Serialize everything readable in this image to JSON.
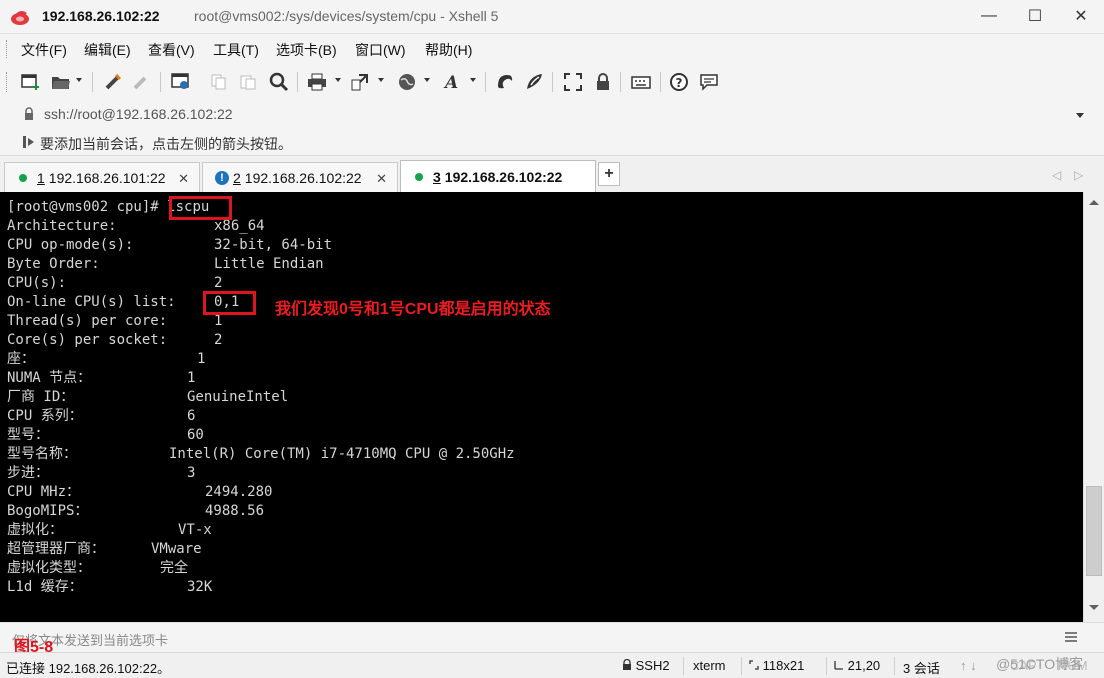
{
  "window": {
    "host": "192.168.26.102:22",
    "path_title": "root@vms002:/sys/devices/system/cpu - Xshell 5",
    "minimize_glyph": "—",
    "maximize_glyph": "☐",
    "close_glyph": "✕"
  },
  "menu": [
    "文件(F)",
    "编辑(E)",
    "查看(V)",
    "工具(T)",
    "选项卡(B)",
    "窗口(W)",
    "帮助(H)"
  ],
  "toolbar": {
    "icons": [
      "new-session-icon",
      "open-folder-icon",
      "reconnect-icon",
      "disconnect-icon",
      "properties-icon",
      "copy-icon",
      "paste-icon",
      "find-icon",
      "print-icon",
      "transfer-icon",
      "globe-icon",
      "font-icon",
      "xftp-icon",
      "xmanager-icon",
      "fullscreen-icon",
      "lock-icon",
      "keyboard-icon",
      "help-icon",
      "chat-icon"
    ]
  },
  "address": {
    "value": "ssh://root@192.168.26.102:22"
  },
  "hint": {
    "text": "要添加当前会话，点击左侧的箭头按钮。"
  },
  "tabs": [
    {
      "number": "1",
      "host": "192.168.26.101:22",
      "status": "connected",
      "active": false
    },
    {
      "number": "2",
      "host": "192.168.26.102:22",
      "status": "warning",
      "active": false
    },
    {
      "number": "3",
      "host": "192.168.26.102:22",
      "status": "connected",
      "active": true
    }
  ],
  "tab_add_glyph": "+",
  "tab_nav_left": "◁",
  "tab_nav_right": "▷",
  "terminal": {
    "prompt": "[root@vms002 cpu]# ",
    "command": "lscpu",
    "rows": [
      {
        "label": "Architecture:",
        "value": "x86_64"
      },
      {
        "label": "CPU op-mode(s):",
        "value": "32-bit, 64-bit"
      },
      {
        "label": "Byte Order:",
        "value": "Little Endian"
      },
      {
        "label": "CPU(s):",
        "value": "2"
      },
      {
        "label": "On-line CPU(s) list:",
        "value": "0,1"
      },
      {
        "label": "Thread(s) per core:",
        "value": "1"
      },
      {
        "label": "Core(s) per socket:",
        "value": "2"
      },
      {
        "label": "座：",
        "value": "1"
      },
      {
        "label": "NUMA 节点：",
        "value": "1"
      },
      {
        "label": "厂商 ID：",
        "value": "GenuineIntel"
      },
      {
        "label": "CPU 系列：",
        "value": "6"
      },
      {
        "label": "型号：",
        "value": "60"
      },
      {
        "label": "型号名称：",
        "value": "Intel(R) Core(TM) i7-4710MQ CPU @ 2.50GHz"
      },
      {
        "label": "步进：",
        "value": "3"
      },
      {
        "label": "CPU MHz：",
        "value": "2494.280"
      },
      {
        "label": "BogoMIPS：",
        "value": "4988.56"
      },
      {
        "label": "虚拟化：",
        "value": "VT-x"
      },
      {
        "label": "超管理器厂商：",
        "value": "VMware"
      },
      {
        "label": "虚拟化类型：",
        "value": "完全"
      },
      {
        "label": "L1d 缓存：",
        "value": "32K"
      }
    ],
    "annotation": "我们发现0号和1号CPU都是启用的状态",
    "annotation_color": "#f01a1f",
    "highlight_color": "#e0141c"
  },
  "sendbar": {
    "placeholder": "仅将文本发送到当前选项卡",
    "figure_label": "图5-8"
  },
  "status": {
    "connection": "已连接 192.168.26.102:22。",
    "protocol": "SSH2",
    "terminal_type": "xterm",
    "size": "118x21",
    "cursor": "21,20",
    "sessions": "3 会话",
    "caps": "CAP",
    "num": "NUM",
    "watermark": "@51CTO博客"
  }
}
